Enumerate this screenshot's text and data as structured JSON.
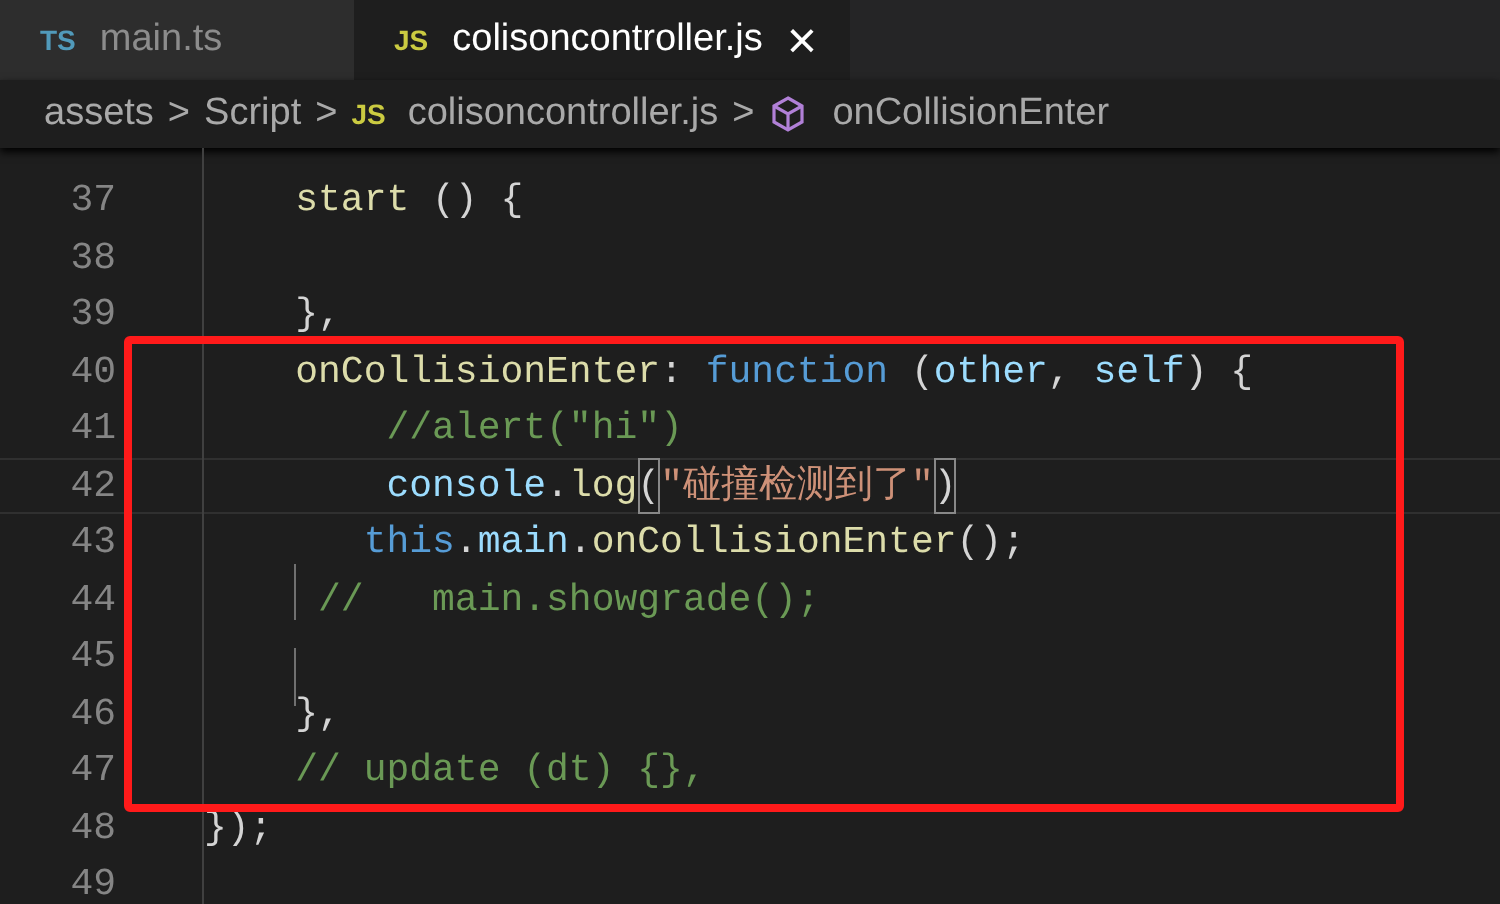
{
  "tabs": [
    {
      "badge": "TS",
      "label": "main.ts",
      "selected": false
    },
    {
      "badge": "JS",
      "label": "colisoncontroller.js",
      "selected": true,
      "close": "×"
    }
  ],
  "breadcrumb": [
    {
      "kind": "folder",
      "label": "assets"
    },
    {
      "kind": "folder",
      "label": "Script"
    },
    {
      "kind": "file",
      "badge": "JS",
      "label": "colisoncontroller.js"
    },
    {
      "kind": "symbol",
      "label": "onCollisionEnter"
    }
  ],
  "separator": ">",
  "lines": [
    {
      "number": "37",
      "current": false,
      "tokens": [
        {
          "kind": "method",
          "text": "    start"
        },
        {
          "kind": "plain",
          "text": " () {"
        }
      ]
    },
    {
      "number": "38",
      "current": false
    },
    {
      "number": "39",
      "current": false,
      "tokens": [
        {
          "kind": "plain",
          "text": "    },"
        }
      ]
    },
    {
      "number": "40",
      "current": false,
      "tokens": [
        {
          "kind": "method",
          "text": "    onCollisionEnter"
        },
        {
          "kind": "plain",
          "text": ": "
        },
        {
          "kind": "keyword",
          "text": "function"
        },
        {
          "kind": "plain",
          "text": " ("
        },
        {
          "kind": "variable",
          "text": "other"
        },
        {
          "kind": "plain",
          "text": ", "
        },
        {
          "kind": "variable",
          "text": "self"
        },
        {
          "kind": "plain",
          "text": ") {"
        }
      ]
    },
    {
      "number": "41",
      "current": false,
      "tokens": [
        {
          "kind": "comment",
          "text": "        //alert(\"hi\")"
        }
      ]
    },
    {
      "number": "42",
      "current": true,
      "tokens": [
        {
          "kind": "variable",
          "text": "        console"
        },
        {
          "kind": "plain",
          "text": "."
        },
        {
          "kind": "method",
          "text": "log"
        },
        {
          "kind": "bracket",
          "text": "("
        },
        {
          "kind": "string",
          "text": "\"碰撞检测到了\""
        },
        {
          "kind": "bracket",
          "text": ")"
        }
      ]
    },
    {
      "number": "43",
      "current": false,
      "tokens": [
        {
          "kind": "keyword",
          "text": "       this"
        },
        {
          "kind": "plain",
          "text": "."
        },
        {
          "kind": "variable",
          "text": "main"
        },
        {
          "kind": "plain",
          "text": "."
        },
        {
          "kind": "method",
          "text": "onCollisionEnter"
        },
        {
          "kind": "plain",
          "text": "();"
        }
      ]
    },
    {
      "number": "44",
      "current": false,
      "tokens": [
        {
          "kind": "comment",
          "text": "     //   main.showgrade();"
        }
      ]
    },
    {
      "number": "45",
      "current": false
    },
    {
      "number": "46",
      "current": false,
      "tokens": [
        {
          "kind": "plain",
          "text": "    },"
        }
      ]
    },
    {
      "number": "47",
      "current": false,
      "tokens": [
        {
          "kind": "comment",
          "text": "    // update (dt) {},"
        }
      ]
    },
    {
      "number": "48",
      "current": false,
      "tokens": [
        {
          "kind": "plain",
          "text": "});"
        }
      ]
    },
    {
      "number": "49",
      "current": false
    }
  ],
  "annotation": {
    "kind": "box",
    "color": "#ff1a1a"
  }
}
